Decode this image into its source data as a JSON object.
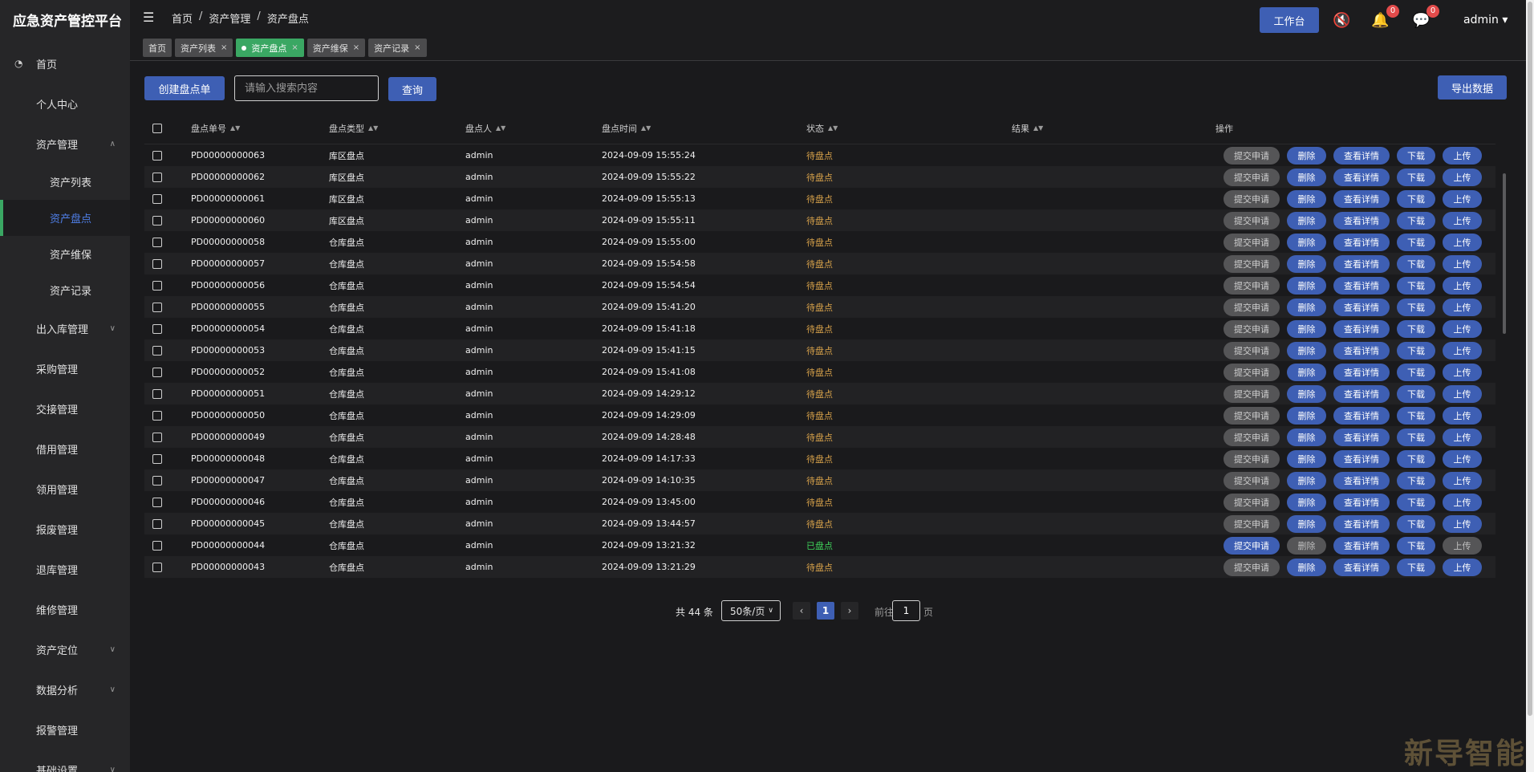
{
  "brand": "应急资产管控平台",
  "sidebar": {
    "items": [
      {
        "label": "首页",
        "icon": "dashboard-icon",
        "chevron": ""
      },
      {
        "label": "个人中心",
        "icon": "",
        "chevron": ""
      },
      {
        "label": "资产管理",
        "icon": "",
        "chevron": "up"
      },
      {
        "label": "出入库管理",
        "icon": "",
        "chevron": "down"
      },
      {
        "label": "采购管理",
        "icon": "",
        "chevron": ""
      },
      {
        "label": "交接管理",
        "icon": "",
        "chevron": ""
      },
      {
        "label": "借用管理",
        "icon": "",
        "chevron": ""
      },
      {
        "label": "领用管理",
        "icon": "",
        "chevron": ""
      },
      {
        "label": "报废管理",
        "icon": "",
        "chevron": ""
      },
      {
        "label": "退库管理",
        "icon": "",
        "chevron": ""
      },
      {
        "label": "维修管理",
        "icon": "",
        "chevron": ""
      },
      {
        "label": "资产定位",
        "icon": "",
        "chevron": "down"
      },
      {
        "label": "数据分析",
        "icon": "",
        "chevron": "down"
      },
      {
        "label": "报警管理",
        "icon": "",
        "chevron": ""
      },
      {
        "label": "基础设置",
        "icon": "",
        "chevron": "down"
      }
    ],
    "asset_sub": [
      "资产列表",
      "资产盘点",
      "资产维保",
      "资产记录"
    ],
    "active_sub": "资产盘点"
  },
  "header": {
    "breadcrumb": [
      "首页",
      "资产管理",
      "资产盘点"
    ],
    "breadcrumb_sep": "/",
    "workbench_label": "工作台",
    "bell_badge": "0",
    "message_badge": "0",
    "user": "admin"
  },
  "tabs": [
    {
      "label": "首页",
      "closable": false,
      "active": false
    },
    {
      "label": "资产列表",
      "closable": true,
      "active": false
    },
    {
      "label": "资产盘点",
      "closable": true,
      "active": true
    },
    {
      "label": "资产维保",
      "closable": true,
      "active": false
    },
    {
      "label": "资产记录",
      "closable": true,
      "active": false
    }
  ],
  "toolbar": {
    "create_label": "创建盘点单",
    "search_placeholder": "请输入搜索内容",
    "query_label": "查询",
    "export_label": "导出数据"
  },
  "table": {
    "columns": [
      "盘点单号",
      "盘点类型",
      "盘点人",
      "盘点时间",
      "状态",
      "结果",
      "操作"
    ],
    "op_labels": {
      "submit": "提交申请",
      "delete": "删除",
      "detail": "查看详情",
      "download": "下载",
      "upload": "上传"
    },
    "rows": [
      {
        "no": "PD00000000063",
        "type": "库区盘点",
        "person": "admin",
        "time": "2024-09-09 15:55:24",
        "status": "待盘点",
        "result": ""
      },
      {
        "no": "PD00000000062",
        "type": "库区盘点",
        "person": "admin",
        "time": "2024-09-09 15:55:22",
        "status": "待盘点",
        "result": ""
      },
      {
        "no": "PD00000000061",
        "type": "库区盘点",
        "person": "admin",
        "time": "2024-09-09 15:55:13",
        "status": "待盘点",
        "result": ""
      },
      {
        "no": "PD00000000060",
        "type": "库区盘点",
        "person": "admin",
        "time": "2024-09-09 15:55:11",
        "status": "待盘点",
        "result": ""
      },
      {
        "no": "PD00000000058",
        "type": "仓库盘点",
        "person": "admin",
        "time": "2024-09-09 15:55:00",
        "status": "待盘点",
        "result": ""
      },
      {
        "no": "PD00000000057",
        "type": "仓库盘点",
        "person": "admin",
        "time": "2024-09-09 15:54:58",
        "status": "待盘点",
        "result": ""
      },
      {
        "no": "PD00000000056",
        "type": "仓库盘点",
        "person": "admin",
        "time": "2024-09-09 15:54:54",
        "status": "待盘点",
        "result": ""
      },
      {
        "no": "PD00000000055",
        "type": "仓库盘点",
        "person": "admin",
        "time": "2024-09-09 15:41:20",
        "status": "待盘点",
        "result": ""
      },
      {
        "no": "PD00000000054",
        "type": "仓库盘点",
        "person": "admin",
        "time": "2024-09-09 15:41:18",
        "status": "待盘点",
        "result": ""
      },
      {
        "no": "PD00000000053",
        "type": "仓库盘点",
        "person": "admin",
        "time": "2024-09-09 15:41:15",
        "status": "待盘点",
        "result": ""
      },
      {
        "no": "PD00000000052",
        "type": "仓库盘点",
        "person": "admin",
        "time": "2024-09-09 15:41:08",
        "status": "待盘点",
        "result": ""
      },
      {
        "no": "PD00000000051",
        "type": "仓库盘点",
        "person": "admin",
        "time": "2024-09-09 14:29:12",
        "status": "待盘点",
        "result": ""
      },
      {
        "no": "PD00000000050",
        "type": "仓库盘点",
        "person": "admin",
        "time": "2024-09-09 14:29:09",
        "status": "待盘点",
        "result": ""
      },
      {
        "no": "PD00000000049",
        "type": "仓库盘点",
        "person": "admin",
        "time": "2024-09-09 14:28:48",
        "status": "待盘点",
        "result": ""
      },
      {
        "no": "PD00000000048",
        "type": "仓库盘点",
        "person": "admin",
        "time": "2024-09-09 14:17:33",
        "status": "待盘点",
        "result": ""
      },
      {
        "no": "PD00000000047",
        "type": "仓库盘点",
        "person": "admin",
        "time": "2024-09-09 14:10:35",
        "status": "待盘点",
        "result": ""
      },
      {
        "no": "PD00000000046",
        "type": "仓库盘点",
        "person": "admin",
        "time": "2024-09-09 13:45:00",
        "status": "待盘点",
        "result": ""
      },
      {
        "no": "PD00000000045",
        "type": "仓库盘点",
        "person": "admin",
        "time": "2024-09-09 13:44:57",
        "status": "待盘点",
        "result": ""
      },
      {
        "no": "PD00000000044",
        "type": "仓库盘点",
        "person": "admin",
        "time": "2024-09-09 13:21:32",
        "status": "已盘点",
        "result": ""
      },
      {
        "no": "PD00000000043",
        "type": "仓库盘点",
        "person": "admin",
        "time": "2024-09-09 13:21:29",
        "status": "待盘点",
        "result": ""
      }
    ]
  },
  "pagination": {
    "total": "共 44 条",
    "page_size": "50条/页",
    "current": "1",
    "goto_label": "前往",
    "goto_value": "1",
    "goto_unit": "页"
  },
  "colors": {
    "primary": "#3e5fb4",
    "active_tab": "#3aa763",
    "pending": "#d8a24a",
    "done": "#3fd35a",
    "sidebar_bg": "#262628",
    "content_bg": "#1a1a1c"
  },
  "watermark": "新导智能"
}
